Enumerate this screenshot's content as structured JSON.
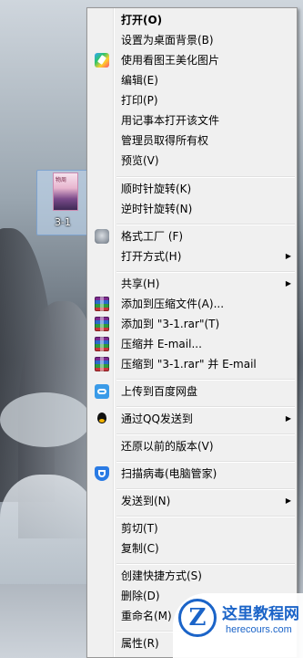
{
  "desktop": {
    "file_label": "3-1",
    "thumb_title": "物周"
  },
  "menu": {
    "items": [
      {
        "label": "打开(O)",
        "bold": true
      },
      {
        "label": "设置为桌面背景(B)"
      },
      {
        "label": "使用看图王美化图片",
        "icon": "meitu-icon"
      },
      {
        "label": "编辑(E)"
      },
      {
        "label": "打印(P)"
      },
      {
        "label": "用记事本打开该文件"
      },
      {
        "label": "管理员取得所有权"
      },
      {
        "label": "预览(V)"
      },
      {
        "label": "顺时针旋转(K)"
      },
      {
        "label": "逆时针旋转(N)"
      },
      {
        "label": "格式工厂 (F)",
        "icon": "format-factory-icon"
      },
      {
        "label": "打开方式(H)",
        "submenu": true
      },
      {
        "label": "共享(H)",
        "submenu": true
      },
      {
        "label": "添加到压缩文件(A)...",
        "icon": "winrar-icon"
      },
      {
        "label": "添加到 \"3-1.rar\"(T)",
        "icon": "winrar-icon"
      },
      {
        "label": "压缩并 E-mail...",
        "icon": "winrar-icon"
      },
      {
        "label": "压缩到 \"3-1.rar\" 并 E-mail",
        "icon": "winrar-icon"
      },
      {
        "label": "上传到百度网盘",
        "icon": "baidu-netdisk-icon"
      },
      {
        "label": "通过QQ发送到",
        "icon": "qq-icon",
        "submenu": true
      },
      {
        "label": "还原以前的版本(V)"
      },
      {
        "label": "扫描病毒(电脑管家)",
        "icon": "tencent-pc-manager-icon"
      },
      {
        "label": "发送到(N)",
        "submenu": true
      },
      {
        "label": "剪切(T)"
      },
      {
        "label": "复制(C)"
      },
      {
        "label": "创建快捷方式(S)"
      },
      {
        "label": "删除(D)"
      },
      {
        "label": "重命名(M)"
      },
      {
        "label": "属性(R)"
      }
    ]
  },
  "watermark": {
    "logo_letter": "Z",
    "title": "这里教程网",
    "url": "herecours.com"
  },
  "colors": {
    "menu_bg": "#f0f0f0",
    "watermark_blue": "#1b64c8"
  }
}
